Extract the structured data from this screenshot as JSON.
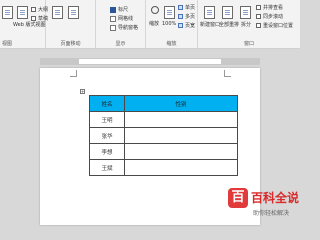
{
  "ribbon": {
    "views_group": {
      "web_layout_label": "Web 版式视图",
      "outline_label": "大纲",
      "draft_label": "草稿",
      "group_label": "视图"
    },
    "move_group": {
      "page_move_label": "页面移动"
    },
    "show_group": {
      "ruler_label": "标尺",
      "gridlines_label": "网格线",
      "nav_pane_label": "导航窗格",
      "group_label": "显示"
    },
    "zoom_group": {
      "zoom_label": "缩放",
      "percent_label": "100%",
      "single_page_label": "单页",
      "multi_page_label": "多页",
      "page_width_label": "页宽",
      "group_label": "缩放"
    },
    "window_group": {
      "new_window_label": "新建窗口",
      "arrange_all_label": "全部重排",
      "split_label": "拆分",
      "side_by_side_label": "并排查看",
      "sync_scroll_label": "同步滚动",
      "reset_pos_label": "重设窗口位置",
      "group_label": "窗口"
    }
  },
  "document": {
    "table": {
      "headers": [
        "姓名",
        "性别"
      ],
      "rows": [
        [
          "王明",
          ""
        ],
        [
          "张华",
          ""
        ],
        [
          "李想",
          ""
        ],
        [
          "王斌",
          ""
        ]
      ]
    }
  },
  "watermark": {
    "title": "百科全说",
    "subtitle": "助你轻松解决",
    "logo_char": "百"
  },
  "colors": {
    "header_fill": "#00b0f0",
    "watermark_red": "#d82a2a"
  }
}
